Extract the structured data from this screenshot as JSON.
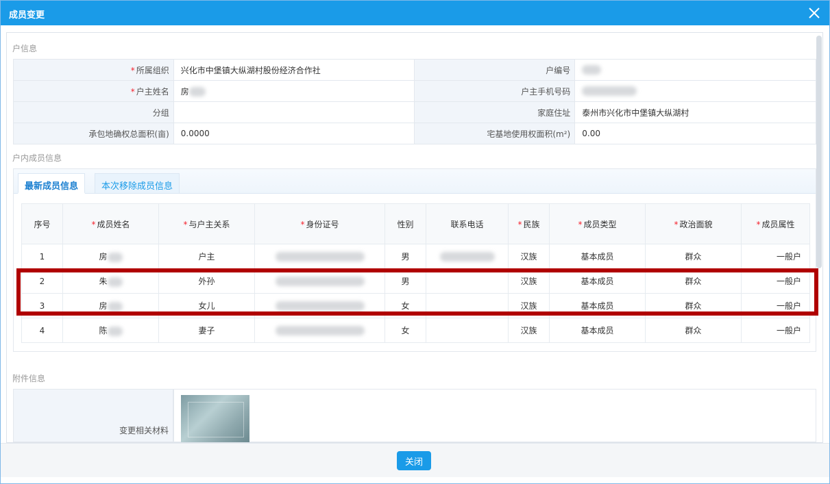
{
  "dialog": {
    "title": "成员变更",
    "close_label": "关闭"
  },
  "household": {
    "section_title": "户信息",
    "rows": [
      {
        "l1": "所属组织",
        "v1": "兴化市中堡镇大纵湖村股份经济合作社",
        "l2": "户编号",
        "v2": "",
        "r1": true,
        "r2": false
      },
      {
        "l1": "户主姓名",
        "v1": "房",
        "l2": "户主手机号码",
        "v2": "",
        "r1": true,
        "r2": false
      },
      {
        "l1": "分组",
        "v1": "",
        "l2": "家庭住址",
        "v2": "泰州市兴化市中堡镇大纵湖村",
        "r1": false,
        "r2": false
      },
      {
        "l1": "承包地确权总面积(亩)",
        "v1": "0.0000",
        "l2": "宅基地使用权面积(m²)",
        "v2": "0.00",
        "r1": false,
        "r2": false
      }
    ]
  },
  "members": {
    "section_title": "户内成员信息",
    "tabs": [
      "最新成员信息",
      "本次移除成员信息"
    ],
    "columns": [
      "序号",
      "成员姓名",
      "与户主关系",
      "身份证号",
      "性别",
      "联系电话",
      "民族",
      "成员类型",
      "政治面貌",
      "成员属性"
    ],
    "required_columns": [
      false,
      true,
      true,
      true,
      false,
      false,
      true,
      true,
      true,
      true
    ],
    "rows": [
      {
        "no": "1",
        "name": "房",
        "relation": "户主",
        "gender": "男",
        "ethnicity": "汉族",
        "type": "基本成员",
        "political": "群众",
        "attr": "一般户"
      },
      {
        "no": "2",
        "name": "朱",
        "relation": "外孙",
        "gender": "男",
        "ethnicity": "汉族",
        "type": "基本成员",
        "political": "群众",
        "attr": "一般户"
      },
      {
        "no": "3",
        "name": "房",
        "relation": "女儿",
        "gender": "女",
        "ethnicity": "汉族",
        "type": "基本成员",
        "political": "群众",
        "attr": "一般户"
      },
      {
        "no": "4",
        "name": "陈",
        "relation": "妻子",
        "gender": "女",
        "ethnicity": "汉族",
        "type": "基本成员",
        "political": "群众",
        "attr": "一般户"
      }
    ]
  },
  "attachments": {
    "section_title": "附件信息",
    "material_label": "变更相关材料"
  },
  "colors": {
    "accent": "#1a9be8",
    "highlight": "#b00000",
    "required": "#f5222d"
  }
}
